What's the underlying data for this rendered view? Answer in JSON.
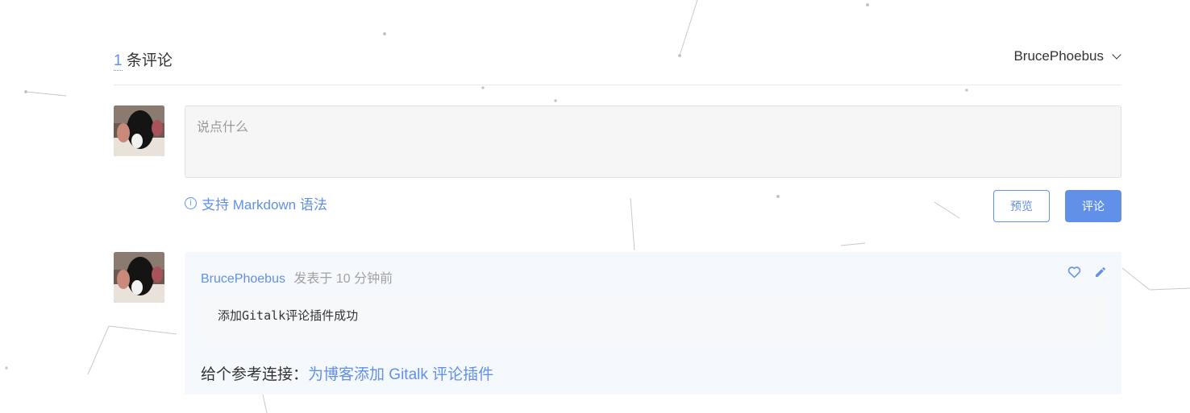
{
  "header": {
    "count": "1",
    "count_suffix": "条评论",
    "user_name": "BrucePhoebus"
  },
  "editor": {
    "placeholder": "说点什么",
    "markdown_tip": "支持 Markdown 语法",
    "info_icon_glyph": "i",
    "preview_label": "预览",
    "submit_label": "评论"
  },
  "comment": {
    "author": "BrucePhoebus",
    "posted_label": "发表于",
    "time": "10 分钟前",
    "code_text": "添加Gitalk评论插件成功",
    "ref_prefix": "给个参考连接：",
    "ref_link": "为博客添加 Gitalk 评论插件"
  },
  "icons": {
    "like": "heart-icon",
    "edit": "pencil-icon",
    "dropdown": "chevron-down-icon",
    "info": "info-icon"
  },
  "colors": {
    "accent": "#6190e8",
    "comment_bg": "#f5f9fe",
    "muted": "#a1a1a1"
  }
}
